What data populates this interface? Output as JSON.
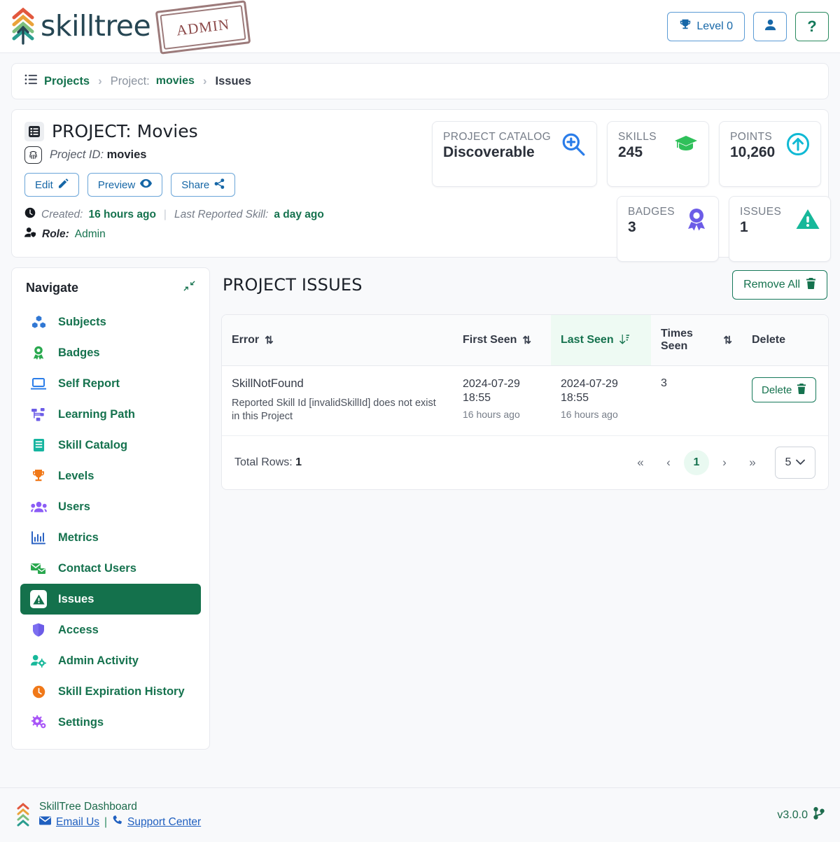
{
  "header": {
    "brand": "skilltree",
    "stamp": "ADMIN",
    "level_button": "Level 0",
    "level_icon": "trophy-icon",
    "user_icon": "user-icon",
    "help_label": "?",
    "accent_green": "#15724e",
    "accent_blue": "#1667a8"
  },
  "breadcrumb": {
    "icon": "list-tree-icon",
    "root": "Projects",
    "sep": "›",
    "project_label": "Project: ",
    "project_name": "movies",
    "current": "Issues"
  },
  "project": {
    "title": "PROJECT: Movies",
    "title_icon": "list-alt-icon",
    "id_icon": "fingerprint-icon",
    "id_label": "Project ID",
    "id_sep": ": ",
    "id_value": "movies",
    "buttons": [
      {
        "label": "Edit",
        "icon": "edit-pencil-icon"
      },
      {
        "label": "Preview",
        "icon": "eye-icon"
      },
      {
        "label": "Share",
        "icon": "share-icon"
      }
    ],
    "created_icon": "clock-icon",
    "created_label": "Created:",
    "created_value": "16 hours ago",
    "divider": "|",
    "last_skill_label": "Last Reported Skill:",
    "last_skill_value": "a day ago",
    "role_icon": "user-shield-icon",
    "role_label": "Role:",
    "role_value": "Admin"
  },
  "tiles": [
    {
      "label": "PROJECT CATALOG",
      "value": "Discoverable",
      "icon": "search-plus-icon",
      "color": "#2b7de9"
    },
    {
      "label": "SKILLS",
      "value": "245",
      "icon": "graduation-cap-icon",
      "color": "#2fc05a"
    },
    {
      "label": "POINTS",
      "value": "10,260",
      "icon": "arrow-up-circle-icon",
      "color": "#0fb9d4"
    },
    {
      "label": "BADGES",
      "value": "3",
      "icon": "award-ribbon-icon",
      "color": "#6c5ce7"
    },
    {
      "label": "ISSUES",
      "value": "1",
      "icon": "warning-triangle-icon",
      "color": "#17b89a"
    }
  ],
  "sidebar": {
    "title": "Navigate",
    "collapse_icon": "compress-arrows-icon",
    "items": [
      {
        "label": "Subjects",
        "icon": "cubes-icon",
        "color": "#3178d4",
        "active": false
      },
      {
        "label": "Badges",
        "icon": "award-ribbon-icon",
        "color": "#2aa84f",
        "active": false
      },
      {
        "label": "Self Report",
        "icon": "laptop-icon",
        "color": "#2b7de9",
        "active": false
      },
      {
        "label": "Learning Path",
        "icon": "project-diagram-icon",
        "color": "#6c5ce7",
        "active": false
      },
      {
        "label": "Skill Catalog",
        "icon": "book-icon",
        "color": "#16b5a0",
        "active": false
      },
      {
        "label": "Levels",
        "icon": "trophy-icon",
        "color": "#f07818",
        "active": false
      },
      {
        "label": "Users",
        "icon": "users-icon",
        "color": "#8b5cf6",
        "active": false
      },
      {
        "label": "Metrics",
        "icon": "bar-chart-icon",
        "color": "#2b63c4",
        "active": false
      },
      {
        "label": "Contact Users",
        "icon": "mail-bulk-icon",
        "color": "#2aa84f",
        "active": false
      },
      {
        "label": "Issues",
        "icon": "warning-triangle-icon",
        "color": "#ffffff",
        "active": true
      },
      {
        "label": "Access",
        "icon": "shield-icon",
        "color": "#6c5ce7",
        "active": false
      },
      {
        "label": "Admin Activity",
        "icon": "users-cog-icon",
        "color": "#17b89a",
        "active": false
      },
      {
        "label": "Skill Expiration History",
        "icon": "clock-icon",
        "color": "#f07818",
        "active": false
      },
      {
        "label": "Settings",
        "icon": "gears-icon",
        "color": "#a855f7",
        "active": false
      }
    ]
  },
  "issues": {
    "title": "PROJECT ISSUES",
    "remove_all_label": "Remove All",
    "remove_all_icon": "trash-icon",
    "columns": [
      {
        "label": "Error",
        "sort": "none"
      },
      {
        "label": "First Seen",
        "sort": "none"
      },
      {
        "label": "Last Seen",
        "sort": "desc"
      },
      {
        "label": "Times Seen",
        "sort": "none"
      },
      {
        "label": "Delete",
        "sort": null
      }
    ],
    "rows": [
      {
        "error": "SkillNotFound",
        "description": "Reported Skill Id [invalidSkillId] does not exist in this Project",
        "first_seen_date": "2024-07-29 18:55",
        "first_seen_ago": "16 hours ago",
        "last_seen_date": "2024-07-29 18:55",
        "last_seen_ago": "16 hours ago",
        "times_seen": "3",
        "delete_label": "Delete",
        "delete_icon": "trash-icon"
      }
    ],
    "pager": {
      "total_label": "Total Rows:",
      "total_value": "1",
      "first": "«",
      "prev": "‹",
      "current_page": "1",
      "next": "›",
      "last": "»",
      "page_size": "5"
    }
  },
  "footer": {
    "dashboard": "SkillTree Dashboard",
    "email_label": "Email Us",
    "email_icon": "envelope-icon",
    "pipe": "|",
    "support_label": "Support Center",
    "support_icon": "phone-icon",
    "version": "v3.0.0",
    "version_icon": "git-branch-icon"
  }
}
